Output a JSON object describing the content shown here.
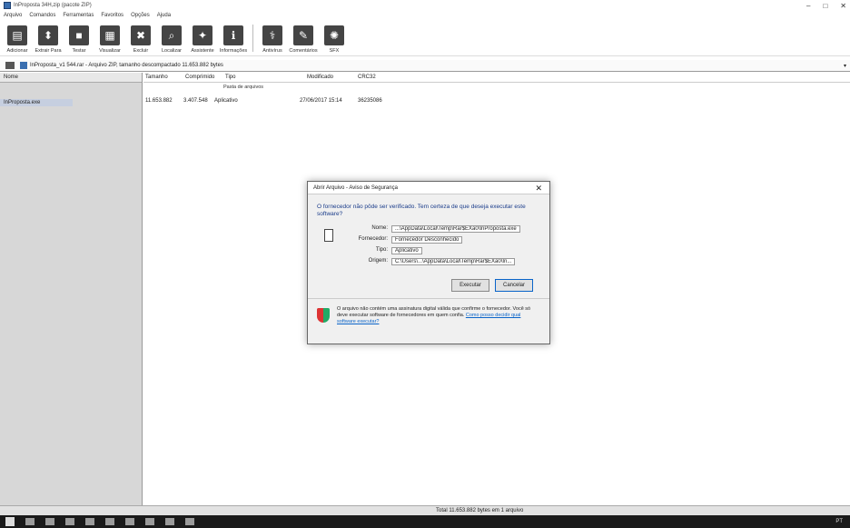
{
  "window": {
    "title": "InProposta 34H,zip (pacote ZIP)",
    "controls": [
      "–",
      "□",
      "✕"
    ]
  },
  "menubar": [
    "Arquivo",
    "Comandos",
    "Ferramentas",
    "Favoritos",
    "Opções",
    "Ajuda"
  ],
  "toolbar": [
    {
      "label": "Adicionar",
      "icon": "add-icon"
    },
    {
      "label": "Extrair Para",
      "icon": "extract-icon"
    },
    {
      "label": "Testar",
      "icon": "test-icon"
    },
    {
      "label": "Visualizar",
      "icon": "view-icon"
    },
    {
      "label": "Excluir",
      "icon": "delete-icon"
    },
    {
      "label": "Localizar",
      "icon": "find-icon"
    },
    {
      "label": "Assistente",
      "icon": "wizard-icon"
    },
    {
      "label": "Informações",
      "icon": "info-icon"
    },
    {
      "label": "Antivírus",
      "icon": "virus-scan-icon"
    },
    {
      "label": "Comentários",
      "icon": "comment-icon"
    },
    {
      "label": "SFX",
      "icon": "sfx-icon"
    }
  ],
  "address": {
    "path": "InProposta_v1 544.rar - Arquivo ZIP, tamanho descompactado 11.653.882 bytes"
  },
  "leftpane": {
    "header": "Nome",
    "item": "InProposta.exe"
  },
  "columns": [
    "Tamanho",
    "Comprimido",
    "Tipo",
    "Modificado",
    "CRC32"
  ],
  "subheader": "Pasta de arquivos",
  "file_row": {
    "size": "11.653.882",
    "packed": "3.407.548",
    "type": "Aplicativo",
    "modified": "27/06/2017 15:14",
    "crc": "36235086"
  },
  "status": {
    "left": "",
    "right": "Total 11.653.882 bytes em 1 arquivo"
  },
  "dialog": {
    "title": "Abrir Arquivo - Aviso de Segurança",
    "question": "O fornecedor não pôde ser verificado. Tem certeza de que deseja executar este software?",
    "fields": {
      "name_label": "Nome:",
      "name_value": "...\\AppData\\Local\\Temp\\Rar$EXa0\\InProposta.exe",
      "publisher_label": "Fornecedor:",
      "publisher_value": "Fornecedor Desconhecido",
      "type_label": "Tipo:",
      "type_value": "Aplicativo",
      "from_label": "Origem:",
      "from_value": "C:\\Users\\...\\AppData\\Local\\Temp\\Rar$EXa0\\In..."
    },
    "buttons": {
      "run": "Executar",
      "cancel": "Cancelar"
    },
    "warning": "O arquivo não contém uma assinatura digital válida que confirme o fornecedor. Você só deve executar software de fornecedores em quem confia.",
    "warning_link": "Como posso decidir qual software executar?"
  },
  "taskbar": {
    "tray_text": "PT"
  }
}
